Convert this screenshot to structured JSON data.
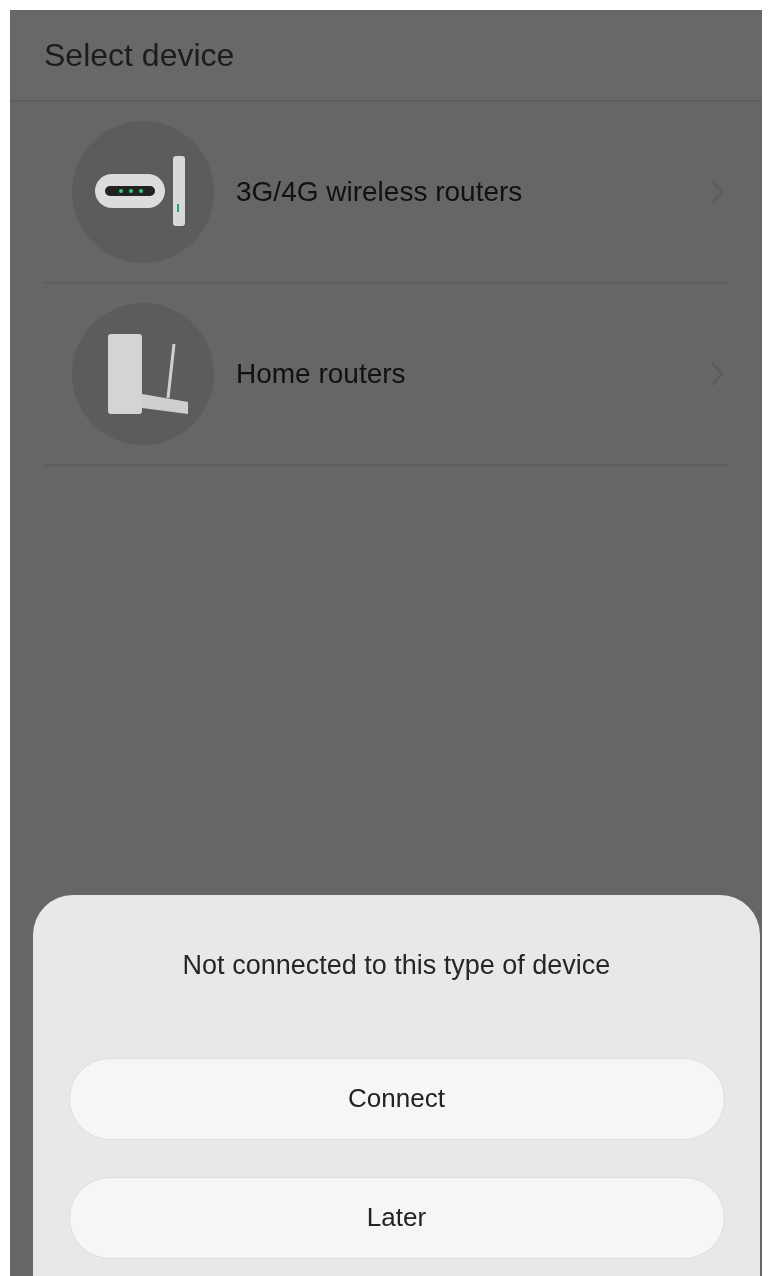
{
  "header": {
    "title": "Select device"
  },
  "device_types": [
    {
      "kind": "mobile",
      "label": "3G/4G wireless routers"
    },
    {
      "kind": "home",
      "label": "Home routers"
    }
  ],
  "dialog": {
    "message": "Not connected to this type of device",
    "buttons": [
      {
        "label": "Connect"
      },
      {
        "label": "Later"
      }
    ]
  }
}
